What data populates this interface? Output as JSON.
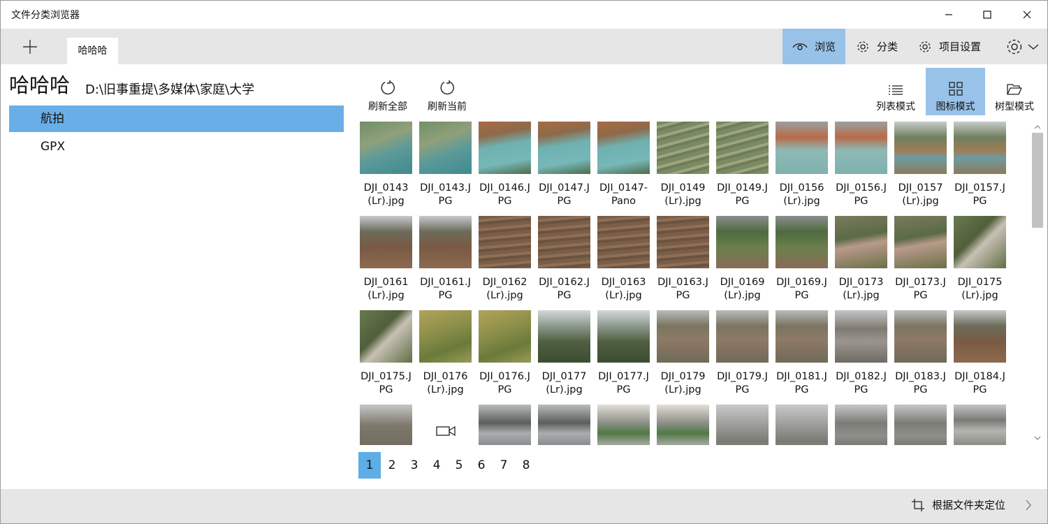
{
  "window": {
    "title": "文件分类浏览器",
    "minimize": "─",
    "maximize": "☐",
    "close": "✕"
  },
  "tabs": {
    "new_tab": "+",
    "items": [
      {
        "label": "哈哈哈"
      }
    ]
  },
  "nav": {
    "browse": "浏览",
    "classify": "分类",
    "project_settings": "项目设置",
    "settings_icon": "gear-icon"
  },
  "sidebar": {
    "title": "哈哈哈",
    "path": "D:\\旧事重提\\多媒体\\家庭\\大学",
    "items": [
      {
        "label": "航拍",
        "selected": true
      },
      {
        "label": "GPX",
        "selected": false
      }
    ]
  },
  "toolbar": {
    "refresh_all": "刷新全部",
    "refresh_current": "刷新当前",
    "list_mode": "列表模式",
    "icon_mode": "图标模式",
    "tree_mode": "树型模式",
    "active_mode": "icon"
  },
  "files": [
    {
      "name": "DJI_0143\n(Lr).jpg",
      "thumb": "lake-a"
    },
    {
      "name": "DJI_0143.J\nPG",
      "thumb": "lake-a"
    },
    {
      "name": "DJI_0146.J\nPG",
      "thumb": "lake-b"
    },
    {
      "name": "DJI_0147.J\nPG",
      "thumb": "lake-b"
    },
    {
      "name": "DJI_0147-\nPano",
      "thumb": "lake-b"
    },
    {
      "name": "DJI_0149\n(Lr).jpg",
      "thumb": "terrace"
    },
    {
      "name": "DJI_0149.J\nPG",
      "thumb": "terrace"
    },
    {
      "name": "DJI_0156\n(Lr).jpg",
      "thumb": "lake-c"
    },
    {
      "name": "DJI_0156.J\nPG",
      "thumb": "lake-c"
    },
    {
      "name": "DJI_0157\n(Lr).jpg",
      "thumb": "valley-lake"
    },
    {
      "name": "DJI_0157.J\nPG",
      "thumb": "valley-lake"
    },
    {
      "name": "DJI_0161\n(Lr).jpg",
      "thumb": "hill-road"
    },
    {
      "name": "DJI_0161.J\nPG",
      "thumb": "hill-road"
    },
    {
      "name": "DJI_0162\n(Lr).jpg",
      "thumb": "fields-brown"
    },
    {
      "name": "DJI_0162.J\nPG",
      "thumb": "fields-brown"
    },
    {
      "name": "DJI_0163\n(Lr).jpg",
      "thumb": "fields-brown"
    },
    {
      "name": "DJI_0163.J\nPG",
      "thumb": "fields-brown"
    },
    {
      "name": "DJI_0169\n(Lr).jpg",
      "thumb": "river-green"
    },
    {
      "name": "DJI_0169.J\nPG",
      "thumb": "river-green"
    },
    {
      "name": "DJI_0173\n(Lr).jpg",
      "thumb": "house-hill"
    },
    {
      "name": "DJI_0173.J\nPG",
      "thumb": "house-hill"
    },
    {
      "name": "DJI_0175\n(Lr).jpg",
      "thumb": "house-top"
    },
    {
      "name": "DJI_0175.J\nPG",
      "thumb": "house-top"
    },
    {
      "name": "DJI_0176\n(Lr).jpg",
      "thumb": "forest-yellow"
    },
    {
      "name": "DJI_0176.J\nPG",
      "thumb": "forest-yellow"
    },
    {
      "name": "DJI_0177\n(Lr).jpg",
      "thumb": "mountain-mist"
    },
    {
      "name": "DJI_0177.J\nPG",
      "thumb": "mountain-mist"
    },
    {
      "name": "DJI_0179\n(Lr).jpg",
      "thumb": "village"
    },
    {
      "name": "DJI_0179.J\nPG",
      "thumb": "village"
    },
    {
      "name": "DJI_0181.J\nPG",
      "thumb": "village"
    },
    {
      "name": "DJI_0182.J\nPG",
      "thumb": "town"
    },
    {
      "name": "DJI_0183.J\nPG",
      "thumb": "village"
    },
    {
      "name": "DJI_0184.J\nPG",
      "thumb": "hill-road"
    },
    {
      "name": "",
      "thumb": "village-grey"
    },
    {
      "name": "",
      "thumb": "video"
    },
    {
      "name": "",
      "thumb": "river-bay"
    },
    {
      "name": "",
      "thumb": "river-bay"
    },
    {
      "name": "",
      "thumb": "river-sunset"
    },
    {
      "name": "",
      "thumb": "river-sunset"
    },
    {
      "name": "",
      "thumb": "city-haze"
    },
    {
      "name": "",
      "thumb": "city-haze"
    },
    {
      "name": "",
      "thumb": "highway"
    },
    {
      "name": "",
      "thumb": "highway"
    },
    {
      "name": "",
      "thumb": "highway-toll"
    }
  ],
  "pagination": {
    "pages": [
      "1",
      "2",
      "3",
      "4",
      "5",
      "6",
      "7",
      "8"
    ],
    "current": "1"
  },
  "status": {
    "locate": "根据文件夹定位",
    "next": "›"
  },
  "colors": {
    "accent": "#99c2e8",
    "selected": "#6aaee8",
    "page_current": "#5dade6",
    "bar_bg": "#e6e6e6"
  }
}
